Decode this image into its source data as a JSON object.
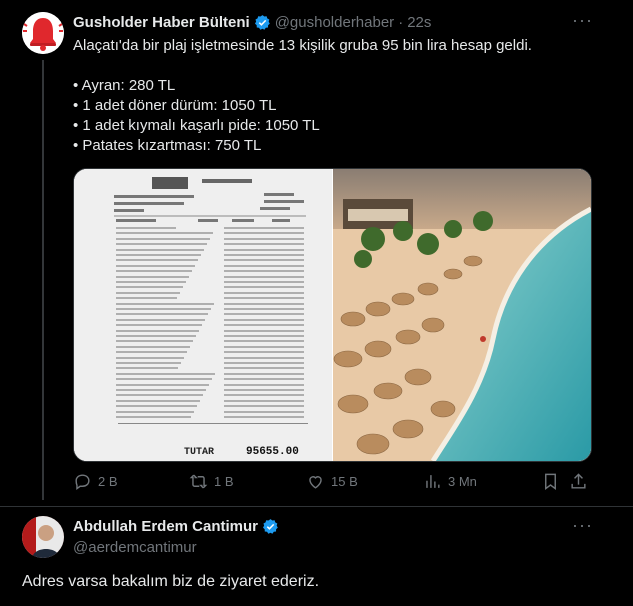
{
  "tweet": {
    "author_name": "Gusholder Haber Bülteni",
    "handle": "@gusholderhaber",
    "separator": "·",
    "time": "22s",
    "text_line1": "Alaçatı'da bir plaj işletmesinde 13 kişilik gruba 95 bin lira hesap geldi.",
    "items": [
      "• Ayran: 280 TL",
      "• 1 adet döner dürüm: 1050 TL",
      "• 1 adet kıymalı kaşarlı pide: 1050 TL",
      "• Patates kızartması: 750 TL"
    ],
    "receipt_total_label": "TUTAR",
    "receipt_total_value": "95655.00",
    "actions": {
      "replies": "2 B",
      "retweets": "1 B",
      "likes": "15 B",
      "views": "3 Mn"
    }
  },
  "reply": {
    "author_name": "Abdullah Erdem Cantimur",
    "handle": "@aerdemcantimur",
    "text": "Adres varsa bakalım biz de ziyaret ederiz."
  },
  "colors": {
    "background": "#000000",
    "text": "#e7e9ea",
    "muted": "#71767b",
    "verified": "#1d9bf0",
    "divider": "#2f3336",
    "bell_red": "#e0282d"
  },
  "icons": {
    "more": "more-dots-icon",
    "verified": "verified-badge-icon",
    "reply": "reply-icon",
    "retweet": "retweet-icon",
    "like": "heart-icon",
    "views": "views-bar-icon",
    "bookmark": "bookmark-icon",
    "share": "share-icon"
  }
}
